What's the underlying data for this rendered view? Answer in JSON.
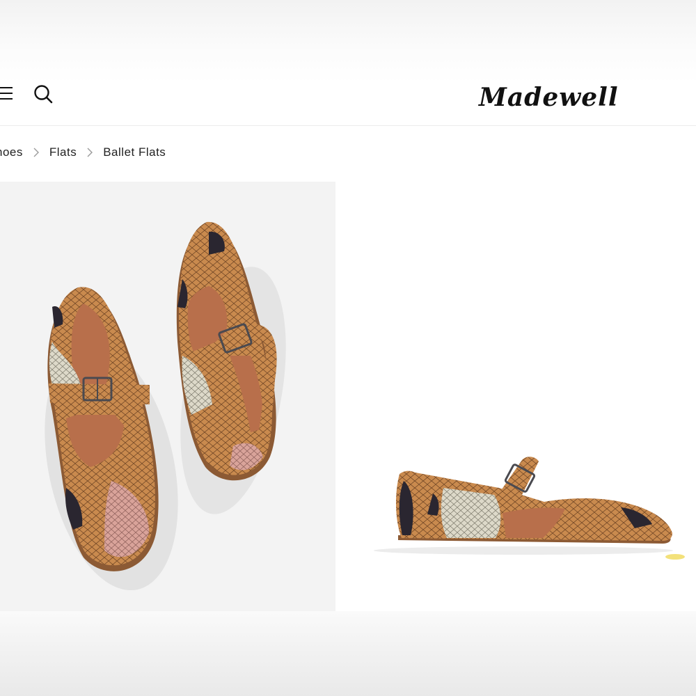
{
  "header": {
    "menu_icon": "hamburger-menu-icon",
    "search_icon": "search-icon",
    "brand": "Madewell"
  },
  "breadcrumb": {
    "items": [
      "hoes",
      "Flats",
      "Ballet Flats"
    ]
  },
  "gallery": {
    "images": [
      "product-photo-top-view",
      "product-photo-side-view"
    ]
  },
  "colors": {
    "snake_tan": "#c98a4e",
    "snake_cream": "#ddd9c9",
    "snake_dark": "#2a2630",
    "snake_pink": "#d9a39a",
    "lining": "#b86f4b",
    "text": "#222222"
  }
}
